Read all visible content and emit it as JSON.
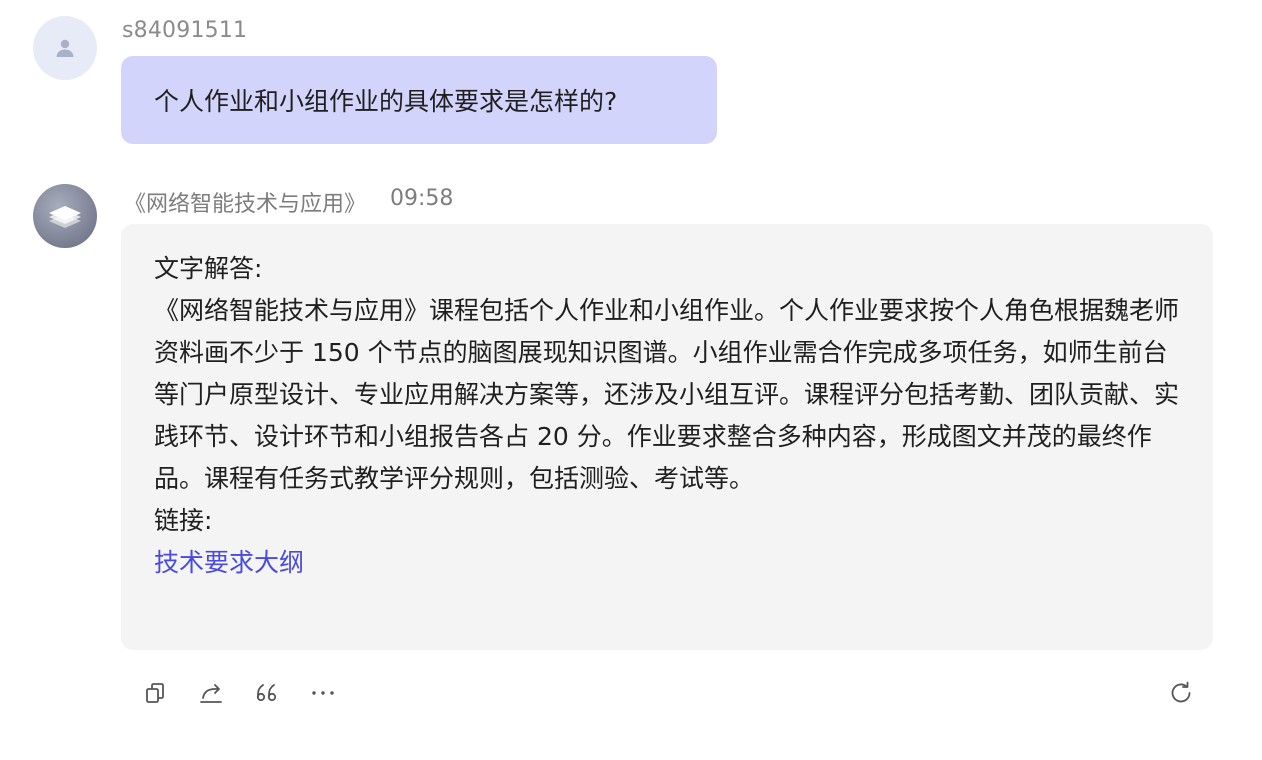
{
  "user_message": {
    "username": "s84091511",
    "text": "个人作业和小组作业的具体要求是怎样的?"
  },
  "bot_message": {
    "name": "《网络智能技术与应用》",
    "time": "09:58",
    "heading": "文字解答:",
    "body": "《网络智能技术与应用》课程包括个人作业和小组作业。个人作业要求按个人角色根据魏老师资料画不少于 150 个节点的脑图展现知识图谱。小组作业需合作完成多项任务，如师生前台等门户原型设计、专业应用解决方案等，还涉及小组互评。课程评分包括考勤、团队贡献、实践环节、设计环节和小组报告各占 20 分。作业要求整合多种内容，形成图文并茂的最终作品。课程有任务式教学评分规则，包括测验、考试等。",
    "links_heading": "链接:",
    "link_text": "技术要求大纲"
  },
  "actions": {
    "icons": [
      "copy-icon",
      "share-icon",
      "quote-icon",
      "more-icon",
      "refresh-icon"
    ]
  },
  "colors": {
    "user_bubble": "#d2d4fb",
    "bot_bubble": "#f4f4f4",
    "link": "#4a4ae0",
    "meta_text": "#7d7d7d"
  }
}
